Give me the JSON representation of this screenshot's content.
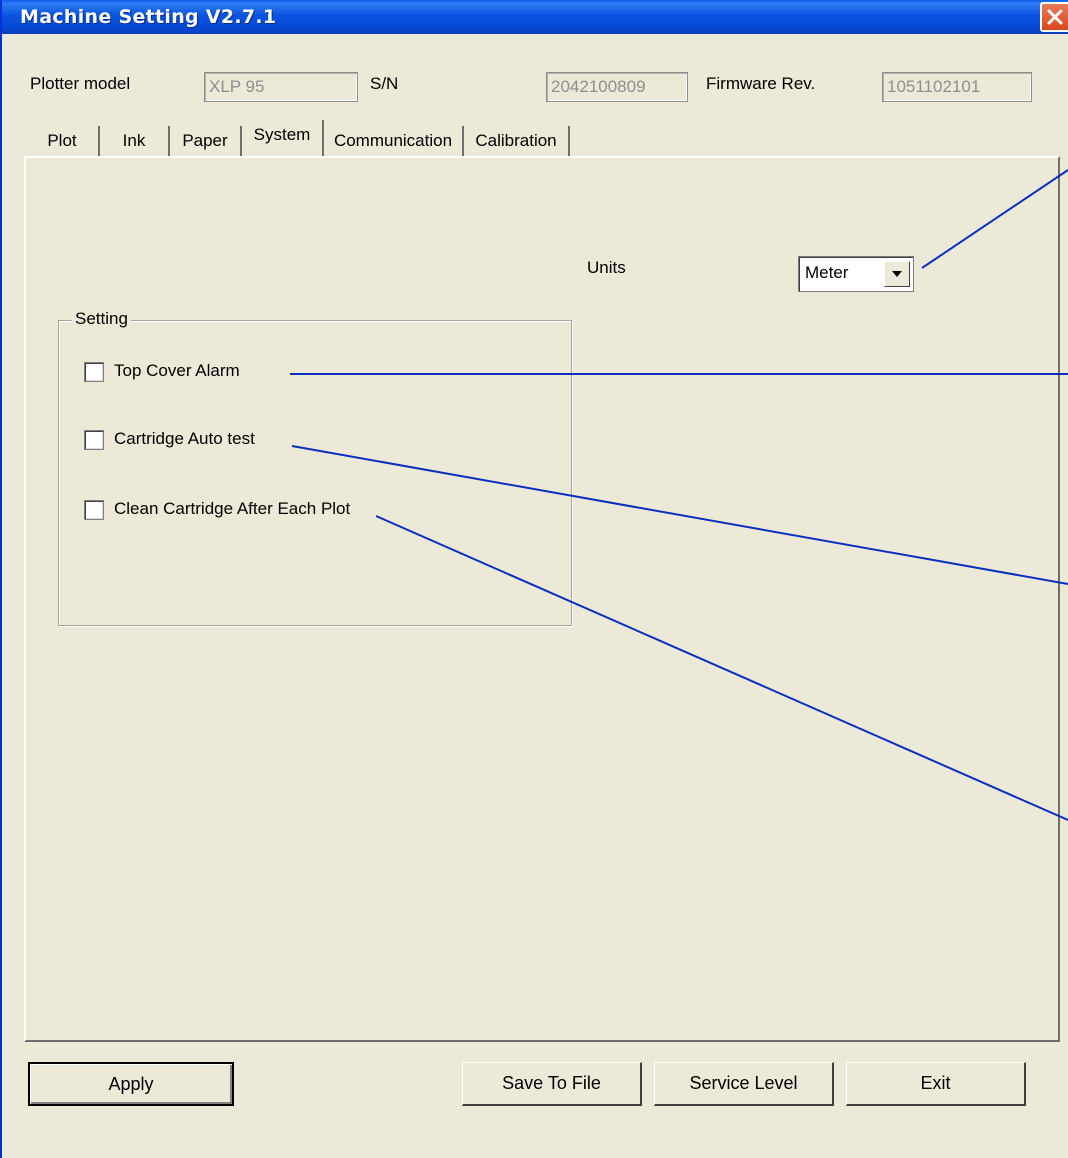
{
  "window": {
    "title": "Machine Setting V2.7.1"
  },
  "header": {
    "plotter_model_label": "Plotter model",
    "plotter_model_value": "XLP 95",
    "sn_label": "S/N",
    "sn_value": "2042100809",
    "firmware_label": "Firmware Rev.",
    "firmware_value": "1051102101"
  },
  "tabs": [
    {
      "label": "Plot"
    },
    {
      "label": "Ink"
    },
    {
      "label": "Paper"
    },
    {
      "label": "System",
      "active": true
    },
    {
      "label": "Communication"
    },
    {
      "label": "Calibration"
    }
  ],
  "system": {
    "units_label": "Units",
    "units_value": "Meter",
    "group_label": "Setting",
    "checkboxes": [
      {
        "label": "Top Cover Alarm",
        "checked": false
      },
      {
        "label": "Cartridge Auto test",
        "checked": false
      },
      {
        "label": "Clean Cartridge After Each Plot",
        "checked": false
      }
    ]
  },
  "buttons": {
    "apply": "Apply",
    "save_to_file": "Save To File",
    "service_level": "Service Level",
    "exit": "Exit"
  },
  "colors": {
    "titlebar": "#0a54e0",
    "dialog_bg": "#ece9d8",
    "annotation_line": "#0a2fbf",
    "close_button": "#d9481c"
  },
  "icons": [
    "close-icon",
    "dropdown-arrow-icon"
  ]
}
